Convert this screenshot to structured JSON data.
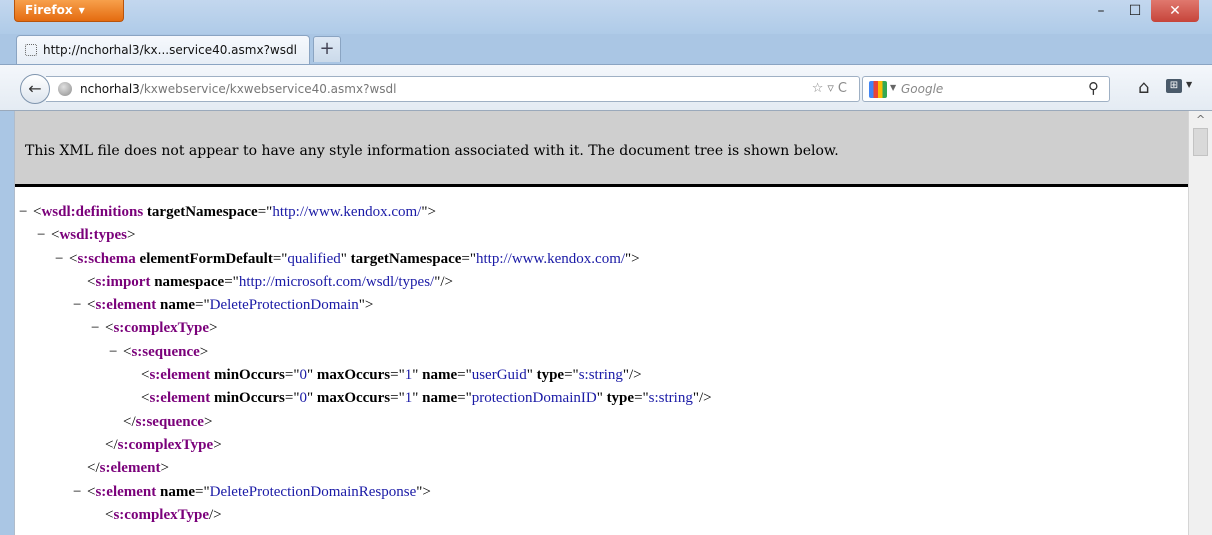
{
  "browser": {
    "menu_label": "Firefox",
    "minimize": "–",
    "maximize": "☐",
    "close": "✕"
  },
  "tab": {
    "label": "http://nchorhal3/kx...service40.asmx?wsdl",
    "new_tab": "+"
  },
  "nav": {
    "back": "←",
    "url_host": "nchorhal3",
    "url_path": "/kxwebservice/kxwebservice40.asmx?wsdl",
    "url_icons": "☆▿C",
    "search_placeholder": "Google",
    "search_icon": "⚲",
    "home": "⌂",
    "addon": "⊞"
  },
  "page": {
    "banner": "This XML file does not appear to have any style information associated with it. The document tree is shown below."
  },
  "xml": [
    {
      "toggle": "−",
      "open": "<",
      "tag": "wsdl:definitions",
      "attrs": [
        {
          "n": "targetNamespace",
          "v": "http://www.kendox.com/"
        }
      ],
      "close": ">"
    },
    {
      "toggle": "−",
      "open": "<",
      "tag": "wsdl:types",
      "attrs": [],
      "close": ">"
    },
    {
      "toggle": "−",
      "open": "<",
      "tag": "s:schema",
      "attrs": [
        {
          "n": "elementFormDefault",
          "v": "qualified"
        },
        {
          "n": "targetNamespace",
          "v": "http://www.kendox.com/"
        }
      ],
      "close": ">"
    },
    {
      "toggle": "",
      "open": "<",
      "tag": "s:import",
      "attrs": [
        {
          "n": "namespace",
          "v": "http://microsoft.com/wsdl/types/"
        }
      ],
      "close": "/>"
    },
    {
      "toggle": "−",
      "open": "<",
      "tag": "s:element",
      "attrs": [
        {
          "n": "name",
          "v": "DeleteProtectionDomain"
        }
      ],
      "close": ">"
    },
    {
      "toggle": "−",
      "open": "<",
      "tag": "s:complexType",
      "attrs": [],
      "close": ">"
    },
    {
      "toggle": "−",
      "open": "<",
      "tag": "s:sequence",
      "attrs": [],
      "close": ">"
    },
    {
      "toggle": "",
      "open": "<",
      "tag": "s:element",
      "attrs": [
        {
          "n": "minOccurs",
          "v": "0"
        },
        {
          "n": "maxOccurs",
          "v": "1"
        },
        {
          "n": "name",
          "v": "userGuid"
        },
        {
          "n": "type",
          "v": "s:string"
        }
      ],
      "close": "/>"
    },
    {
      "toggle": "",
      "open": "<",
      "tag": "s:element",
      "attrs": [
        {
          "n": "minOccurs",
          "v": "0"
        },
        {
          "n": "maxOccurs",
          "v": "1"
        },
        {
          "n": "name",
          "v": "protectionDomainID"
        },
        {
          "n": "type",
          "v": "s:string"
        }
      ],
      "close": "/>"
    },
    {
      "toggle": "",
      "open": "</",
      "tag": "s:sequence",
      "attrs": [],
      "close": ">"
    },
    {
      "toggle": "",
      "open": "</",
      "tag": "s:complexType",
      "attrs": [],
      "close": ">"
    },
    {
      "toggle": "",
      "open": "</",
      "tag": "s:element",
      "attrs": [],
      "close": ">"
    },
    {
      "toggle": "−",
      "open": "<",
      "tag": "s:element",
      "attrs": [
        {
          "n": "name",
          "v": "DeleteProtectionDomainResponse"
        }
      ],
      "close": ">"
    },
    {
      "toggle": "",
      "open": "<",
      "tag": "s:complexType",
      "attrs": [],
      "close": "/>"
    }
  ]
}
